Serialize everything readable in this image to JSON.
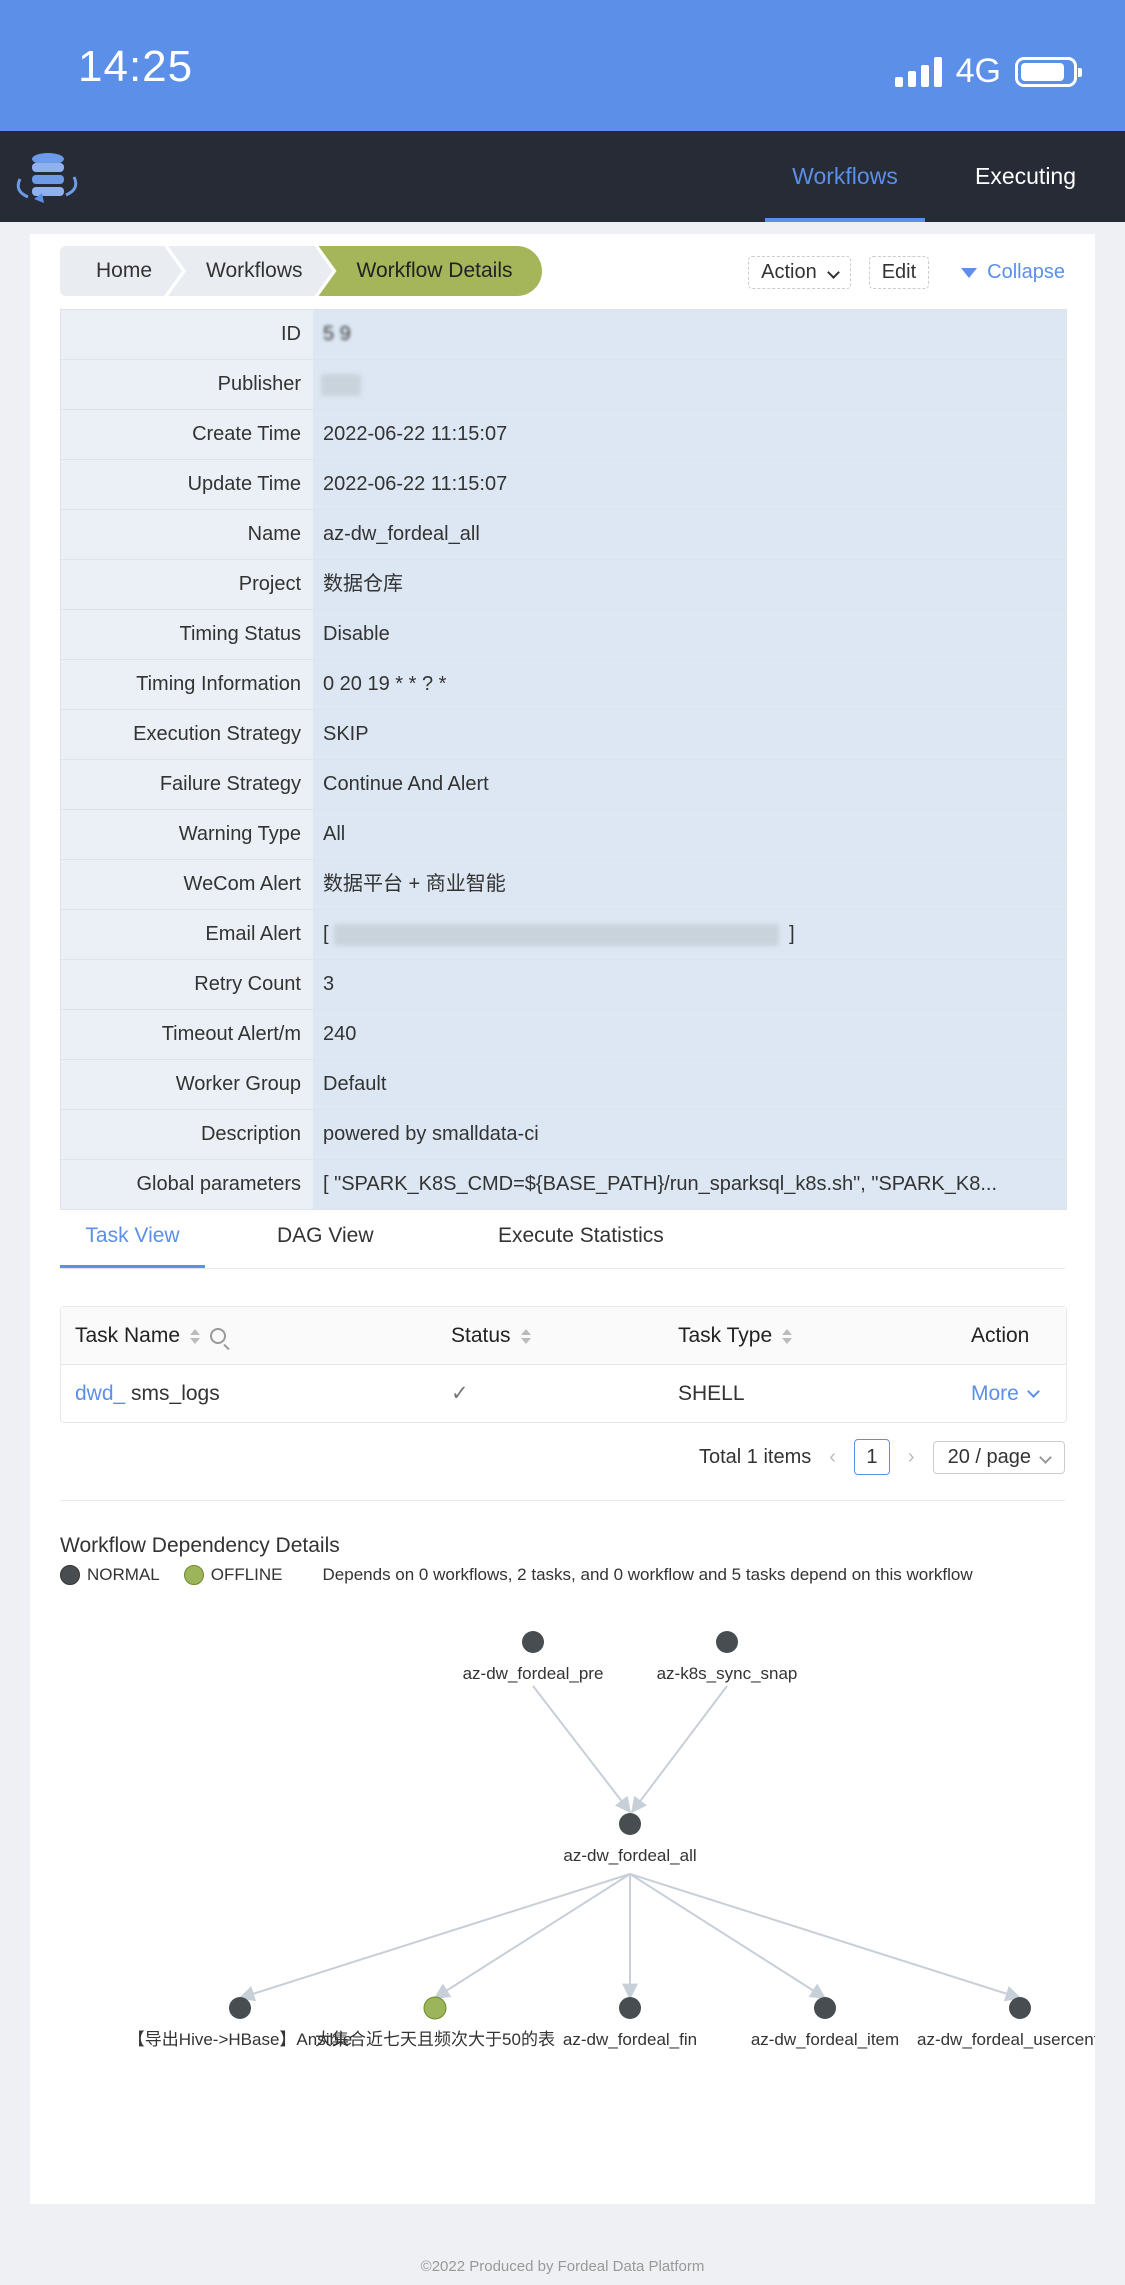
{
  "status_bar": {
    "time": "14:25",
    "network": "4G"
  },
  "nav": {
    "tabs": [
      "Workflows",
      "Executing"
    ]
  },
  "breadcrumb": [
    "Home",
    "Workflows",
    "Workflow Details"
  ],
  "actions": {
    "action": "Action",
    "edit": "Edit",
    "collapse": "Collapse"
  },
  "details": [
    {
      "label": "ID",
      "value": "5  9"
    },
    {
      "label": "Publisher",
      "value": ""
    },
    {
      "label": "Create Time",
      "value": "2022-06-22 11:15:07"
    },
    {
      "label": "Update Time",
      "value": "2022-06-22 11:15:07"
    },
    {
      "label": "Name",
      "value": "az-dw_fordeal_all"
    },
    {
      "label": "Project",
      "value": "数据仓库"
    },
    {
      "label": "Timing Status",
      "value": "Disable"
    },
    {
      "label": "Timing Information",
      "value": "0 20 19 * * ? *"
    },
    {
      "label": "Execution Strategy",
      "value": "SKIP"
    },
    {
      "label": "Failure Strategy",
      "value": "Continue And Alert"
    },
    {
      "label": "Warning Type",
      "value": "All"
    },
    {
      "label": "WeCom Alert",
      "value": "数据平台 + 商业智能"
    },
    {
      "label": "Email Alert",
      "value": "[ "
    },
    {
      "label": "Retry Count",
      "value": "3"
    },
    {
      "label": "Timeout Alert/m",
      "value": "240"
    },
    {
      "label": "Worker Group",
      "value": "Default"
    },
    {
      "label": "Description",
      "value": "powered by smalldata-ci"
    },
    {
      "label": "Global parameters",
      "value": "[ \"SPARK_K8S_CMD=${BASE_PATH}/run_sparksql_k8s.sh\", \"SPARK_K8..."
    }
  ],
  "email_close": "]",
  "view_tabs": [
    "Task View",
    "DAG View",
    "Execute Statistics"
  ],
  "table": {
    "headers": [
      "Task Name",
      "Status",
      "Task Type",
      "Action"
    ],
    "row": {
      "name_prefix": "dwd_",
      "name_rest": " sms_logs",
      "status": "✓",
      "type": "SHELL",
      "action": "More"
    }
  },
  "pagination": {
    "total": "Total 1 items",
    "page": "1",
    "size": "20 / page"
  },
  "dependency": {
    "title": "Workflow Dependency Details",
    "legend": [
      {
        "label": "NORMAL",
        "color": "#474d50"
      },
      {
        "label": "OFFLINE",
        "color": "#9db55a"
      }
    ],
    "summary": "Depends on 0 workflows, 2 tasks, and 0 workflow and 5 tasks depend on this workflow",
    "nodes": [
      {
        "label": "az-dw_fordeal_pre",
        "status": "NORMAL"
      },
      {
        "label": "az-k8s_sync_snap",
        "status": "NORMAL"
      },
      {
        "label": "az-dw_fordeal_all",
        "status": "NORMAL"
      },
      {
        "label": "【导出Hive->HBase】Ansible",
        "status": "NORMAL"
      },
      {
        "label": "大集合近七天且频次大于50的表",
        "status": "OFFLINE"
      },
      {
        "label": "az-dw_fordeal_fin",
        "status": "NORMAL"
      },
      {
        "label": "az-dw_fordeal_item",
        "status": "NORMAL"
      },
      {
        "label": "az-dw_fordeal_usercenter_",
        "status": "NORMAL"
      }
    ]
  },
  "footer": "©2022 Produced by Fordeal Data Platform",
  "colors": {
    "brand": "#5b8fe8",
    "navbar": "#262b36",
    "offline": "#9db55a",
    "normal": "#474d50"
  }
}
